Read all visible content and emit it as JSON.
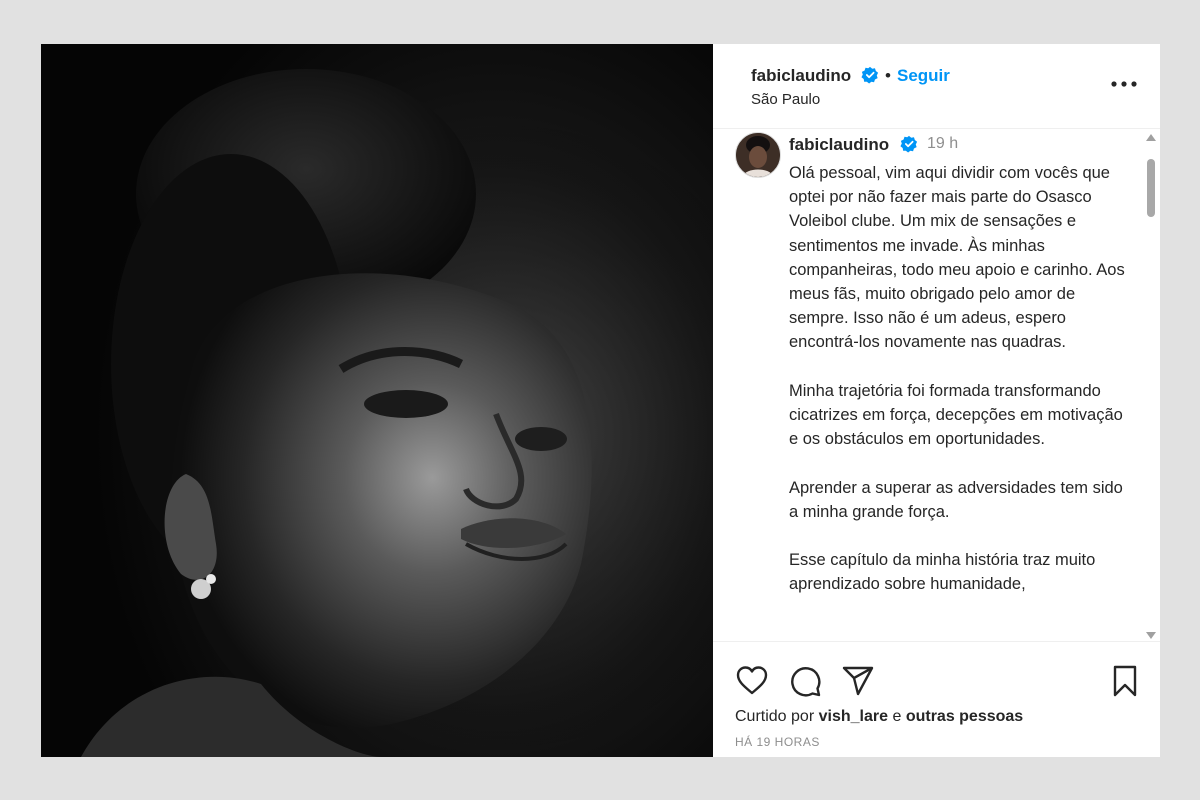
{
  "header": {
    "username": "fabiclaudino",
    "dot": "•",
    "follow_label": "Seguir",
    "location": "São Paulo"
  },
  "caption": {
    "username": "fabiclaudino",
    "time": "19 h",
    "paragraphs": [
      "Olá pessoal, vim aqui dividir com vocês que optei por não fazer mais parte do Osasco Voleibol clube. Um mix de sensações e sentimentos me invade. Às minhas companheiras, todo meu apoio e carinho. Aos meus fãs, muito obrigado pelo amor de sempre. Isso não é um adeus, espero encontrá-los novamente nas quadras.",
      "Minha trajetória foi formada transformando cicatrizes em força, decepções em motivação e os obstáculos em oportunidades.",
      "Aprender a superar as adversidades tem sido a minha grande força.",
      "Esse capítulo da minha história traz muito aprendizado sobre humanidade,"
    ]
  },
  "likes": {
    "prefix": "Curtido por",
    "user": "vish_lare",
    "conj": "e",
    "others": "outras pessoas"
  },
  "timestamp": "HÁ 19 HORAS",
  "icons": {
    "verified": "verified-badge-icon",
    "more": "more-options-icon",
    "like": "heart-icon",
    "comment": "comment-icon",
    "share": "send-icon",
    "save": "bookmark-icon"
  },
  "colors": {
    "accent": "#0095f6",
    "text": "#262626",
    "muted": "#8e8e8e",
    "background": "#e1e1e1"
  }
}
